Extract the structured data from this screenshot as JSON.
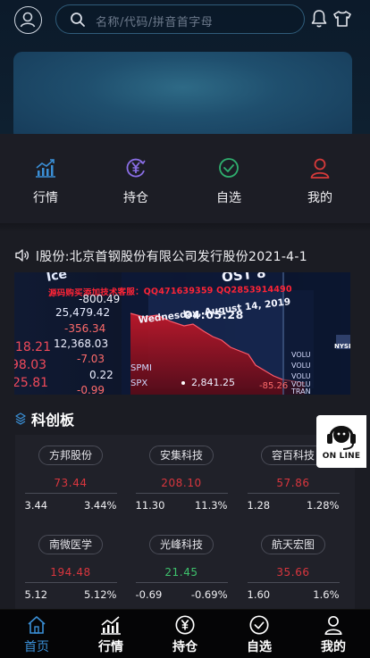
{
  "search": {
    "placeholder": "名称/代码/拼音首字母"
  },
  "quick_menu": [
    {
      "label": "行情",
      "icon": "chart-trend-icon"
    },
    {
      "label": "持仓",
      "icon": "yen-coin-icon"
    },
    {
      "label": "自选",
      "icon": "check-circle-icon"
    },
    {
      "label": "我的",
      "icon": "user-icon"
    }
  ],
  "notice": {
    "text": "l股份:北京首钢股份有限公司发行股份2021-4-1"
  },
  "banner_overlay": {
    "red_text": "源码购买添加技术客服：QQ471639359 QQ2853914490",
    "sign": "04:05:28",
    "date": "Wednesday, August 14, 2019",
    "left_numbers": [
      "-800.49",
      "25,479.42",
      "-356.34",
      "12,368.03",
      "-7.03",
      "218.21",
      "98.03",
      "0.22",
      "25.81",
      "-0.99"
    ],
    "labels": [
      "SPMI",
      "SPX"
    ],
    "bottom_value": "2,841.25",
    "bottom_value2": "-85.26",
    "right_labels": [
      "VOLU",
      "VOLU",
      "VOLU",
      "VOLU",
      "TRAN"
    ],
    "corner_text": "Ice",
    "corner_text2": "OST 8",
    "right_tag": "NYSE"
  },
  "section": {
    "title": "科创板"
  },
  "stocks": [
    {
      "name": "方邦股份",
      "price": "73.44",
      "change": "3.44",
      "pct": "3.44%",
      "trend": "up"
    },
    {
      "name": "安集科技",
      "price": "208.10",
      "change": "11.30",
      "pct": "11.3%",
      "trend": "up"
    },
    {
      "name": "容百科技",
      "price": "57.86",
      "change": "1.28",
      "pct": "1.28%",
      "trend": "up"
    },
    {
      "name": "南微医学",
      "price": "194.48",
      "change": "5.12",
      "pct": "5.12%",
      "trend": "up"
    },
    {
      "name": "光峰科技",
      "price": "21.45",
      "change": "-0.69",
      "pct": "-0.69%",
      "trend": "down"
    },
    {
      "name": "航天宏图",
      "price": "35.66",
      "change": "1.60",
      "pct": "1.6%",
      "trend": "up"
    }
  ],
  "online_badge": {
    "text": "ON LINE"
  },
  "bottom_nav": [
    {
      "label": "首页",
      "icon": "home-icon",
      "active": true
    },
    {
      "label": "行情",
      "icon": "chart-trend-icon",
      "active": false
    },
    {
      "label": "持仓",
      "icon": "yen-coin-icon",
      "active": false
    },
    {
      "label": "自选",
      "icon": "check-circle-icon",
      "active": false
    },
    {
      "label": "我的",
      "icon": "user-icon",
      "active": false
    }
  ],
  "colors": {
    "up": "#d9363e",
    "down": "#3ec16c",
    "accent": "#3a8fd6"
  }
}
